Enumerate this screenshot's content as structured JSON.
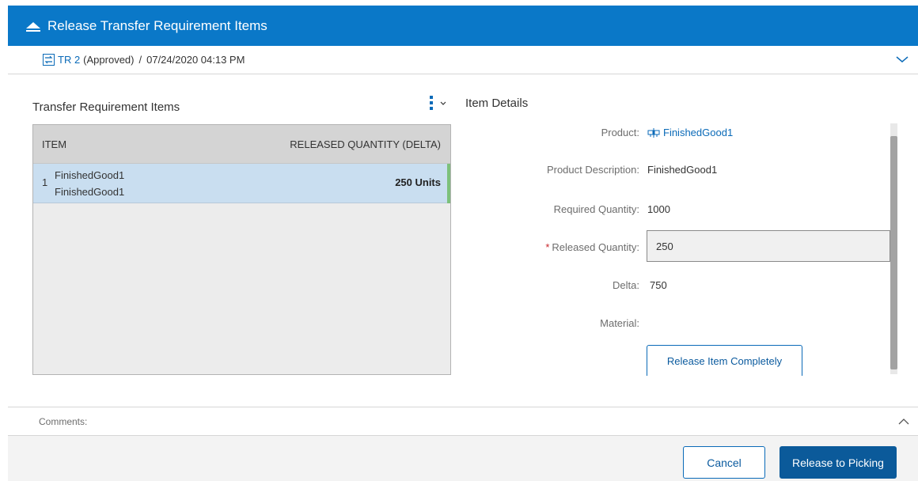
{
  "dialog": {
    "title": "Release Transfer Requirement Items",
    "home_icon": "caret-up-icon"
  },
  "summary": {
    "tr_link": "TR 2",
    "status": "(Approved)",
    "separator": "/",
    "date": "07/24/2020 04:13 PM"
  },
  "items_panel": {
    "title": "Transfer Requirement Items",
    "columns": [
      "ITEM",
      "RELEASED QUANTITY (DELTA)"
    ],
    "rows": [
      {
        "num": "1",
        "line1": "FinishedGood1",
        "line2": "FinishedGood1",
        "qty": "250 Units"
      }
    ]
  },
  "details": {
    "title": "Item Details",
    "product_label": "Product:",
    "product_value": "FinishedGood1",
    "description_label": "Product Description:",
    "description_value": "FinishedGood1",
    "required_label": "Required Quantity:",
    "required_value": "1000",
    "released_required_mark": "*",
    "released_label": "Released Quantity:",
    "released_value": "250",
    "delta_label": "Delta:",
    "delta_value": "750",
    "material_label": "Material:",
    "material_value": "",
    "release_button": "Release Item Completely"
  },
  "comments": {
    "label": "Comments:"
  },
  "footer": {
    "cancel": "Cancel",
    "release": "Release to Picking"
  },
  "colors": {
    "header_blue": "#0a78c8",
    "primary_button": "#0b5a9a",
    "link_blue": "#0a6ab8",
    "selected_row": "#c9def0",
    "row_flag_green": "#7dc07b",
    "required_red": "#c8262b"
  }
}
